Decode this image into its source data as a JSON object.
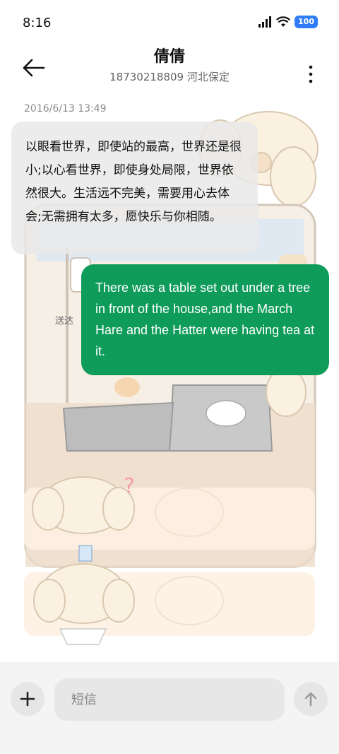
{
  "status": {
    "time": "8:16",
    "battery": "100"
  },
  "header": {
    "name": "倩倩",
    "subtitle": "18730218809 河北保定"
  },
  "conversation": {
    "timestamp": "2016/6/13 13:49",
    "incoming": {
      "text": "以眼看世界，即使站的最高，世界还是很小;以心看世界，即使身处局限，世界依然很大。生活远不完美，需要用心去体会;无需拥有太多，愿快乐与你相随。"
    },
    "outgoing": {
      "text": "There was a table set out under a tree in front of the house,and the March Hare and the Hatter were having tea at it.",
      "status": "送达"
    }
  },
  "composer": {
    "placeholder": "短信"
  },
  "colors": {
    "accent": "#0f9b5a",
    "battery": "#2f7cf6"
  },
  "icons": [
    "signal-icon",
    "wifi-icon",
    "battery-icon",
    "back-arrow-icon",
    "more-vert-icon",
    "plus-icon",
    "send-arrow-icon"
  ]
}
